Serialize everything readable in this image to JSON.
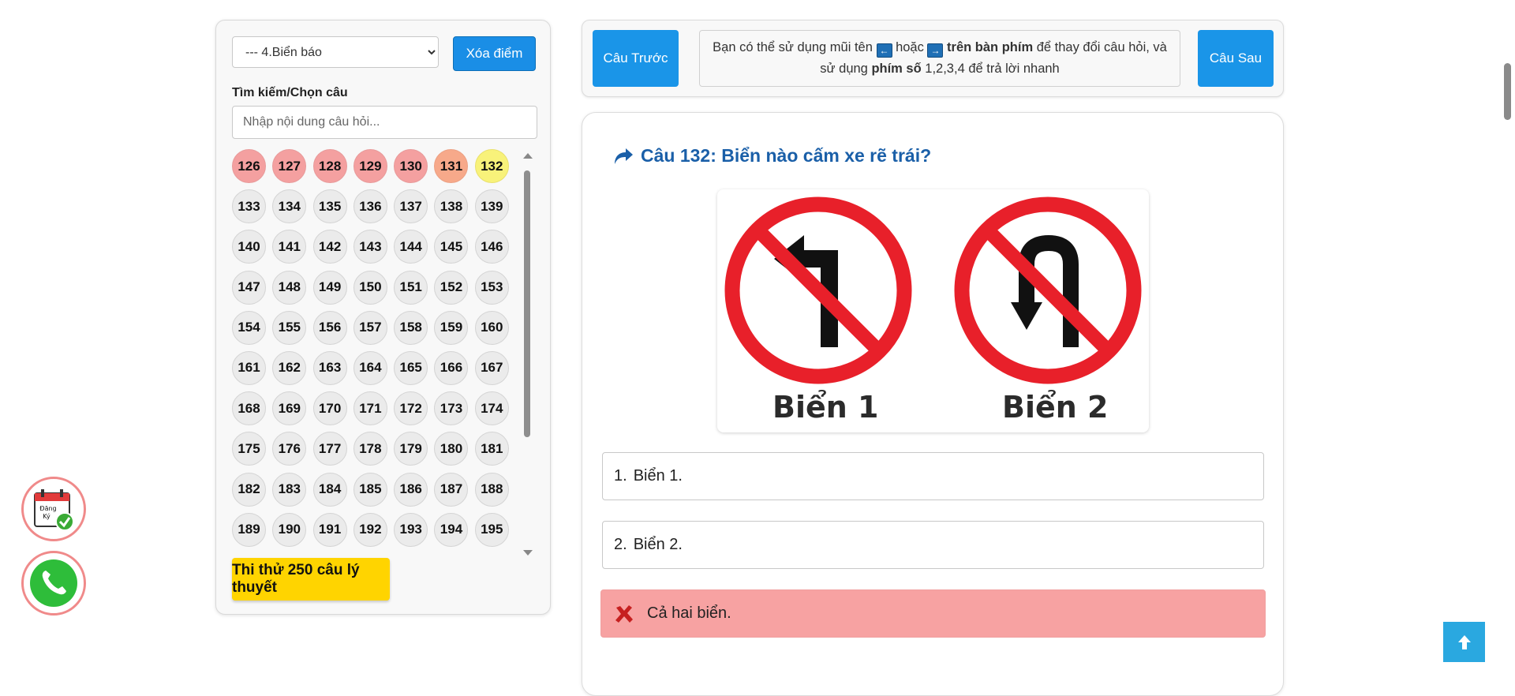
{
  "sidebar": {
    "topic_select": {
      "value": "--- 4.Biển báo"
    },
    "clear_button": "Xóa điểm",
    "search_label": "Tìm kiếm/Chọn câu",
    "search_placeholder": "Nhập nội dung câu hỏi...",
    "questions": [
      {
        "n": "126",
        "s": "wrong"
      },
      {
        "n": "127",
        "s": "wrong"
      },
      {
        "n": "128",
        "s": "wrong"
      },
      {
        "n": "129",
        "s": "wrong"
      },
      {
        "n": "130",
        "s": "wrong"
      },
      {
        "n": "131",
        "s": "partial"
      },
      {
        "n": "132",
        "s": "current"
      },
      {
        "n": "133",
        "s": ""
      },
      {
        "n": "134",
        "s": ""
      },
      {
        "n": "135",
        "s": ""
      },
      {
        "n": "136",
        "s": ""
      },
      {
        "n": "137",
        "s": ""
      },
      {
        "n": "138",
        "s": ""
      },
      {
        "n": "139",
        "s": ""
      },
      {
        "n": "140",
        "s": ""
      },
      {
        "n": "141",
        "s": ""
      },
      {
        "n": "142",
        "s": ""
      },
      {
        "n": "143",
        "s": ""
      },
      {
        "n": "144",
        "s": ""
      },
      {
        "n": "145",
        "s": ""
      },
      {
        "n": "146",
        "s": ""
      },
      {
        "n": "147",
        "s": ""
      },
      {
        "n": "148",
        "s": ""
      },
      {
        "n": "149",
        "s": ""
      },
      {
        "n": "150",
        "s": ""
      },
      {
        "n": "151",
        "s": ""
      },
      {
        "n": "152",
        "s": ""
      },
      {
        "n": "153",
        "s": ""
      },
      {
        "n": "154",
        "s": ""
      },
      {
        "n": "155",
        "s": ""
      },
      {
        "n": "156",
        "s": ""
      },
      {
        "n": "157",
        "s": ""
      },
      {
        "n": "158",
        "s": ""
      },
      {
        "n": "159",
        "s": ""
      },
      {
        "n": "160",
        "s": ""
      },
      {
        "n": "161",
        "s": ""
      },
      {
        "n": "162",
        "s": ""
      },
      {
        "n": "163",
        "s": ""
      },
      {
        "n": "164",
        "s": ""
      },
      {
        "n": "165",
        "s": ""
      },
      {
        "n": "166",
        "s": ""
      },
      {
        "n": "167",
        "s": ""
      },
      {
        "n": "168",
        "s": ""
      },
      {
        "n": "169",
        "s": ""
      },
      {
        "n": "170",
        "s": ""
      },
      {
        "n": "171",
        "s": ""
      },
      {
        "n": "172",
        "s": ""
      },
      {
        "n": "173",
        "s": ""
      },
      {
        "n": "174",
        "s": ""
      },
      {
        "n": "175",
        "s": ""
      },
      {
        "n": "176",
        "s": ""
      },
      {
        "n": "177",
        "s": ""
      },
      {
        "n": "178",
        "s": ""
      },
      {
        "n": "179",
        "s": ""
      },
      {
        "n": "180",
        "s": ""
      },
      {
        "n": "181",
        "s": ""
      },
      {
        "n": "182",
        "s": ""
      },
      {
        "n": "183",
        "s": ""
      },
      {
        "n": "184",
        "s": ""
      },
      {
        "n": "185",
        "s": ""
      },
      {
        "n": "186",
        "s": ""
      },
      {
        "n": "187",
        "s": ""
      },
      {
        "n": "188",
        "s": ""
      },
      {
        "n": "189",
        "s": ""
      },
      {
        "n": "190",
        "s": ""
      },
      {
        "n": "191",
        "s": ""
      },
      {
        "n": "192",
        "s": ""
      },
      {
        "n": "193",
        "s": ""
      },
      {
        "n": "194",
        "s": ""
      },
      {
        "n": "195",
        "s": ""
      }
    ],
    "mock_test_button": "Thi thử 250 câu lý thuyết"
  },
  "nav": {
    "prev_button": "Câu Trước",
    "next_button": "Câu Sau",
    "hint": {
      "t1": "Bạn có thể sử dụng mũi tên ",
      "left_key": "←",
      "t2": " hoặc ",
      "right_key": "→",
      "t3": " ",
      "bold1": "trên bàn phím",
      "t4": " để thay đổi câu hỏi, và sử dụng ",
      "bold2": "phím số",
      "t5": " 1,2,3,4 để trả lời nhanh"
    }
  },
  "question": {
    "title": "Câu 132: Biển nào cấm xe rẽ trái?",
    "sign1_label": "Biển 1",
    "sign2_label": "Biển 2",
    "answers": [
      {
        "num": "1.",
        "text": "Biển 1.",
        "state": "normal"
      },
      {
        "num": "2.",
        "text": "Biển 2.",
        "state": "normal"
      },
      {
        "num": "",
        "text": "Cả hai biển.",
        "state": "wrong"
      }
    ]
  },
  "floating": {
    "register_label_1": "Đăng",
    "register_label_2": "Ký"
  },
  "colors": {
    "primary_blue": "#1a95e8",
    "wrong_red": "#f7a2a2",
    "current_yellow": "#f8f27a",
    "cta_yellow": "#ffd400",
    "sign_red": "#e8202a"
  }
}
